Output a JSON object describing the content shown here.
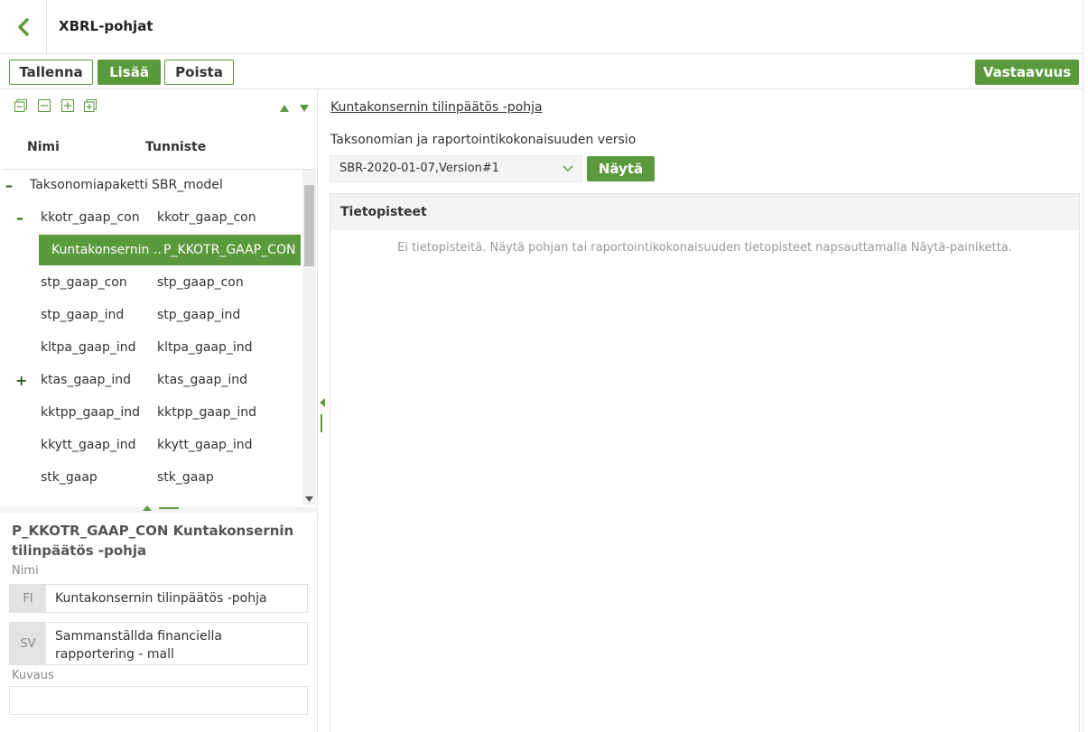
{
  "header": {
    "title": "XBRL-pohjat"
  },
  "toolbar": {
    "save": "Tallenna",
    "add": "Lisää",
    "delete": "Poista",
    "correspondence": "Vastaavuus"
  },
  "tree": {
    "col_name": "Nimi",
    "col_id": "Tunniste",
    "rows": [
      {
        "toggle": "–",
        "name": "Taksonomiapaketti",
        "id": "SBR_model"
      },
      {
        "toggle": "–",
        "name": "kkotr_gaap_con",
        "id": "kkotr_gaap_con"
      },
      {
        "toggle": "",
        "name": "Kuntakonsernin ...",
        "id": "P_KKOTR_GAAP_CON"
      },
      {
        "toggle": "",
        "name": "stp_gaap_con",
        "id": "stp_gaap_con"
      },
      {
        "toggle": "",
        "name": "stp_gaap_ind",
        "id": "stp_gaap_ind"
      },
      {
        "toggle": "",
        "name": "kltpa_gaap_ind",
        "id": "kltpa_gaap_ind"
      },
      {
        "toggle": "+",
        "name": "ktas_gaap_ind",
        "id": "ktas_gaap_ind"
      },
      {
        "toggle": "",
        "name": "kktpp_gaap_ind",
        "id": "kktpp_gaap_ind"
      },
      {
        "toggle": "",
        "name": "kkytt_gaap_ind",
        "id": "kkytt_gaap_ind"
      },
      {
        "toggle": "",
        "name": "stk_gaap",
        "id": "stk_gaap"
      }
    ]
  },
  "detail": {
    "title": "P_KKOTR_GAAP_CON Kuntakonsernin tilinpäätös -pohja",
    "name_label": "Nimi",
    "fi_tag": "FI",
    "fi_value": "Kuntakonsernin tilinpäätös -pohja",
    "sv_tag": "SV",
    "sv_value": "Sammanställda financiella rapportering - mall",
    "desc_label": "Kuvaus",
    "desc_value": ""
  },
  "main": {
    "template_link": "Kuntakonsernin tilinpäätös -pohja",
    "version_label": "Taksonomian ja raportointikokonaisuuden versio",
    "version_value": "SBR-2020-01-07,Version#1",
    "show_button": "Näytä",
    "datapoints_header": "Tietopisteet",
    "datapoints_empty": "Ei tietopisteitä. Näytä pohjan tai raportointikokonaisuuden tietopisteet napsauttamalla Näytä-painiketta."
  },
  "colors": {
    "accent": "#5a9a3c",
    "dark_accent": "#2e5c1c"
  },
  "icons": [
    "back-chevron-icon",
    "collapse-all-icon",
    "collapse-icon",
    "expand-icon",
    "expand-all-icon",
    "move-up-icon",
    "move-down-icon",
    "dropdown-chevron-icon"
  ]
}
